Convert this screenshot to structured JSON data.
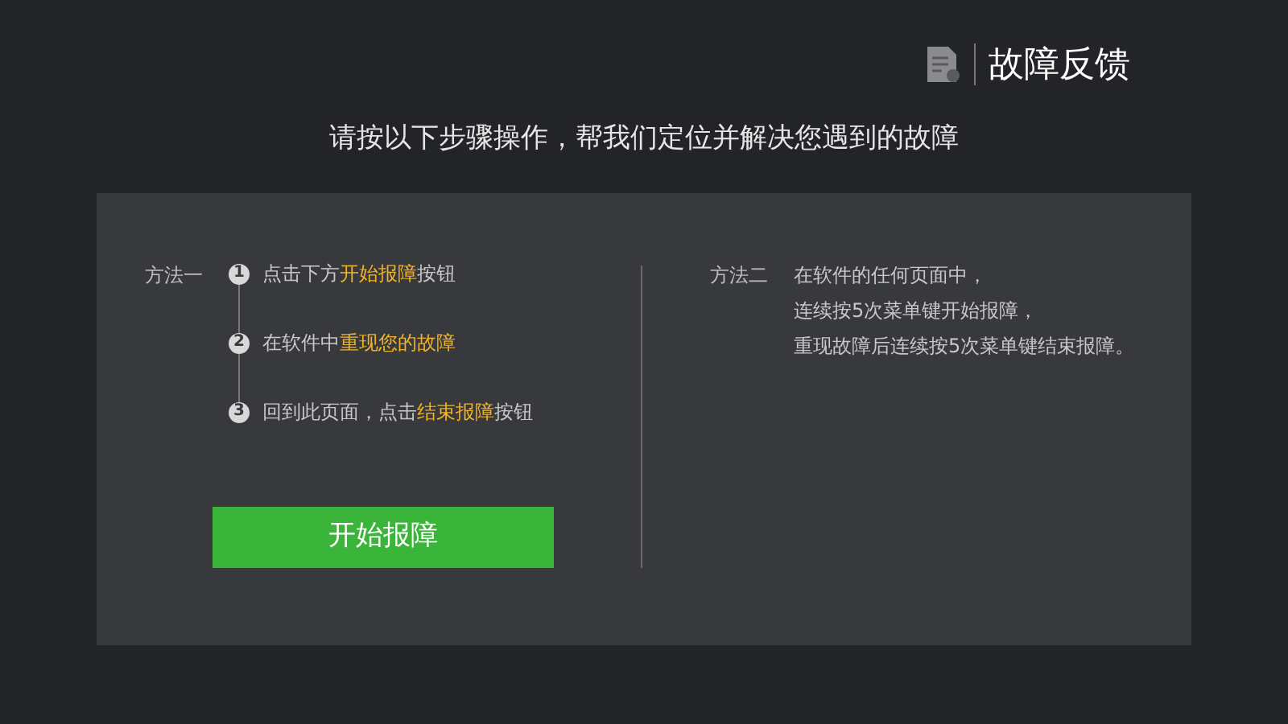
{
  "header": {
    "title": "故障反馈"
  },
  "subtitle": "请按以下步骤操作，帮我们定位并解决您遇到的故障",
  "method_one": {
    "label": "方法一",
    "steps": [
      {
        "number": "1",
        "segments": [
          {
            "text": "点击下方",
            "highlight": false
          },
          {
            "text": "开始报障",
            "highlight": true
          },
          {
            "text": "按钮",
            "highlight": false
          }
        ]
      },
      {
        "number": "2",
        "segments": [
          {
            "text": "在软件中",
            "highlight": false
          },
          {
            "text": "重现您的故障",
            "highlight": true
          }
        ]
      },
      {
        "number": "3",
        "segments": [
          {
            "text": "回到此页面，点击",
            "highlight": false
          },
          {
            "text": "结束报障",
            "highlight": true
          },
          {
            "text": "按钮",
            "highlight": false
          }
        ]
      }
    ],
    "button": "开始报障"
  },
  "method_two": {
    "label": "方法二",
    "lines": [
      "在软件的任何页面中，",
      "连续按5次菜单键开始报障，",
      "重现故障后连续按5次菜单键结束报障。"
    ]
  }
}
